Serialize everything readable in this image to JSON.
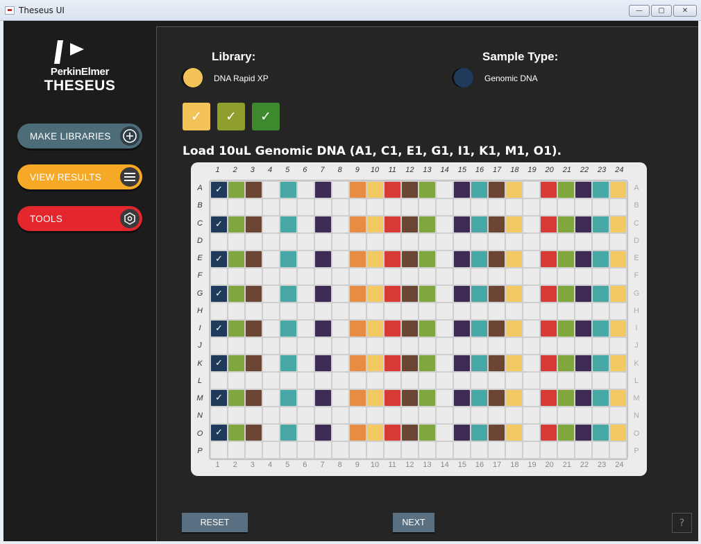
{
  "window": {
    "title": "Theseus UI"
  },
  "logo": {
    "company": "PerkinElmer",
    "product": "THESEUS"
  },
  "sidebar": {
    "items": [
      {
        "label": "MAKE LIBRARIES",
        "icon": "plus-circle-icon"
      },
      {
        "label": "VIEW RESULTS",
        "icon": "menu-icon"
      },
      {
        "label": "TOOLS",
        "icon": "hexagon-icon"
      }
    ]
  },
  "header": {
    "library_title": "Library:",
    "library_value": "DNA Rapid XP",
    "library_color": "#f3c359",
    "sample_type_title": "Sample Type:",
    "sample_type_value": "Genomic DNA",
    "sample_type_color": "#1f3a5a"
  },
  "steps": [
    {
      "state": "complete",
      "color": "#f3c359"
    },
    {
      "state": "complete",
      "color": "#8f9e2c"
    },
    {
      "state": "complete",
      "color": "#3c8a2d"
    }
  ],
  "instruction": "Load 10uL Genomic DNA (A1, C1, E1, G1, I1, K1, M1, O1).",
  "plate": {
    "columns": [
      "1",
      "2",
      "3",
      "4",
      "5",
      "6",
      "7",
      "8",
      "9",
      "10",
      "11",
      "12",
      "13",
      "14",
      "15",
      "16",
      "17",
      "18",
      "19",
      "20",
      "21",
      "22",
      "23",
      "24"
    ],
    "rows": [
      "A",
      "B",
      "C",
      "D",
      "E",
      "F",
      "G",
      "H",
      "I",
      "J",
      "K",
      "L",
      "M",
      "N",
      "O",
      "P"
    ],
    "filled_rows": [
      "A",
      "C",
      "E",
      "G",
      "I",
      "K",
      "M",
      "O"
    ],
    "checked_column": "1",
    "palette": {
      "navy": "#1f3a5a",
      "green": "#7fa73e",
      "brown": "#6b4634",
      "teal": "#48a8a6",
      "purple": "#3d2a55",
      "orange": "#e78d43",
      "yellow": "#f2c963",
      "red": "#d83a35",
      "empty": "#ebebeb"
    },
    "column_colors": [
      "navy",
      "green",
      "brown",
      "empty",
      "teal",
      "empty",
      "purple",
      "empty",
      "orange",
      "yellow",
      "red",
      "brown",
      "green",
      "empty",
      "purple",
      "teal",
      "brown",
      "yellow",
      "empty",
      "red",
      "green",
      "purple",
      "teal",
      "yellow"
    ]
  },
  "footer": {
    "reset_label": "RESET",
    "next_label": "NEXT",
    "help_label": "?"
  }
}
